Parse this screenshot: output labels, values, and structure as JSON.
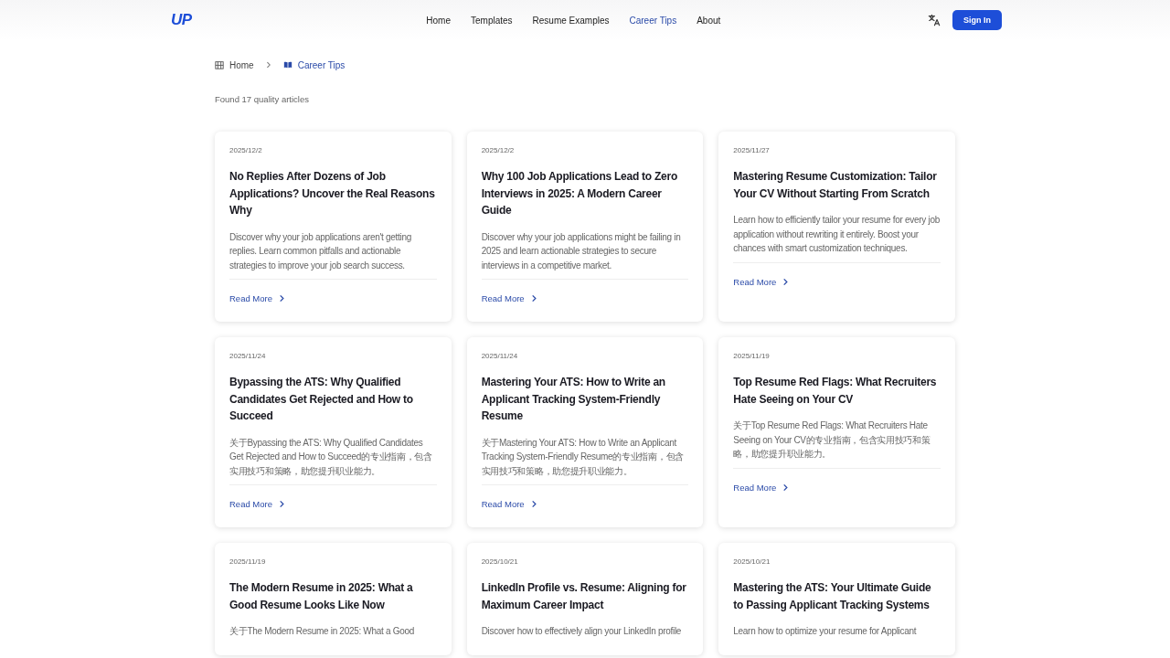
{
  "header": {
    "logo": "UP",
    "nav": [
      {
        "label": "Home",
        "selected": false
      },
      {
        "label": "Templates",
        "selected": false
      },
      {
        "label": "Resume Examples",
        "selected": false
      },
      {
        "label": "Career Tips",
        "selected": true
      },
      {
        "label": "About",
        "selected": false
      }
    ],
    "sign_in": "Sign In"
  },
  "breadcrumb": [
    {
      "label": "Home",
      "current": false
    },
    {
      "label": "Career Tips",
      "current": true
    }
  ],
  "result_count": "Found 17 quality articles",
  "articles": [
    {
      "date": "2025/12/2",
      "title": "No Replies After Dozens of Job Applications? Uncover the Real Reasons Why",
      "summary": "Discover why your job applications aren't getting replies. Learn common pitfalls and actionable strategies to improve your job search success.",
      "link": "Read More"
    },
    {
      "date": "2025/12/2",
      "title": "Why 100 Job Applications Lead to Zero Interviews in 2025: A Modern Career Guide",
      "summary": "Discover why your job applications might be failing in 2025 and learn actionable strategies to secure interviews in a competitive market.",
      "link": "Read More"
    },
    {
      "date": "2025/11/27",
      "title": "Mastering Resume Customization: Tailor Your CV Without Starting From Scratch",
      "summary": "Learn how to efficiently tailor your resume for every job application without rewriting it entirely. Boost your chances with smart customization techniques.",
      "link": "Read More"
    },
    {
      "date": "2025/11/24",
      "title": "Bypassing the ATS: Why Qualified Candidates Get Rejected and How to Succeed",
      "summary": "关于Bypassing the ATS: Why Qualified Candidates Get Rejected and How to Succeed的专业指南，包含实用技巧和策略，助您提升职业能力。",
      "link": "Read More"
    },
    {
      "date": "2025/11/24",
      "title": "Mastering Your ATS: How to Write an Applicant Tracking System-Friendly Resume",
      "summary": "关于Mastering Your ATS: How to Write an Applicant Tracking System-Friendly Resume的专业指南，包含实用技巧和策略，助您提升职业能力。",
      "link": "Read More"
    },
    {
      "date": "2025/11/19",
      "title": "Top Resume Red Flags: What Recruiters Hate Seeing on Your CV",
      "summary": "关于Top Resume Red Flags: What Recruiters Hate Seeing on Your CV的专业指南，包含实用技巧和策略，助您提升职业能力。",
      "link": "Read More"
    },
    {
      "date": "2025/11/19",
      "title": "The Modern Resume in 2025: What a Good Resume Looks Like Now",
      "summary": "关于The Modern Resume in 2025: What a Good"
    },
    {
      "date": "2025/10/21",
      "title": "LinkedIn Profile vs. Resume: Aligning for Maximum Career Impact",
      "summary": "Discover how to effectively align your LinkedIn profile"
    },
    {
      "date": "2025/10/21",
      "title": "Mastering the ATS: Your Ultimate Guide to Passing Applicant Tracking Systems",
      "summary": "Learn how to optimize your resume for Applicant"
    }
  ]
}
